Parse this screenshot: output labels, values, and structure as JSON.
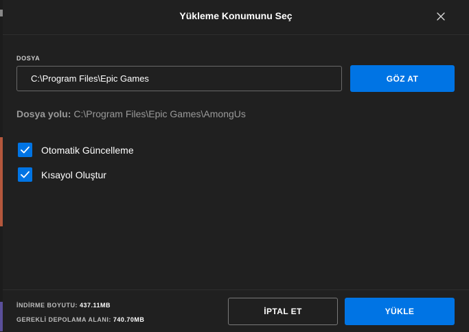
{
  "dialog": {
    "title": "Yükleme Konumunu Seç",
    "close_icon": "close-icon"
  },
  "folder": {
    "section_label": "DOSYA",
    "path_value": "C:\\Program Files\\Epic Games",
    "browse_label": "GÖZ AT"
  },
  "file_path": {
    "label": "Dosya yolu:",
    "value": "C:\\Program Files\\Epic Games\\AmongUs"
  },
  "options": [
    {
      "label": "Otomatik Güncelleme",
      "checked": true
    },
    {
      "label": "Kısayol Oluştur",
      "checked": true
    }
  ],
  "footer": {
    "download_size_label": "İNDİRME BOYUTU:",
    "download_size_value": "437.11MB",
    "required_storage_label": "GEREKLİ DEPOLAMA ALANI:",
    "required_storage_value": "740.70MB",
    "cancel_label": "İPTAL ET",
    "install_label": "YÜKLE"
  },
  "colors": {
    "accent": "#0074e4",
    "background": "#202020"
  }
}
